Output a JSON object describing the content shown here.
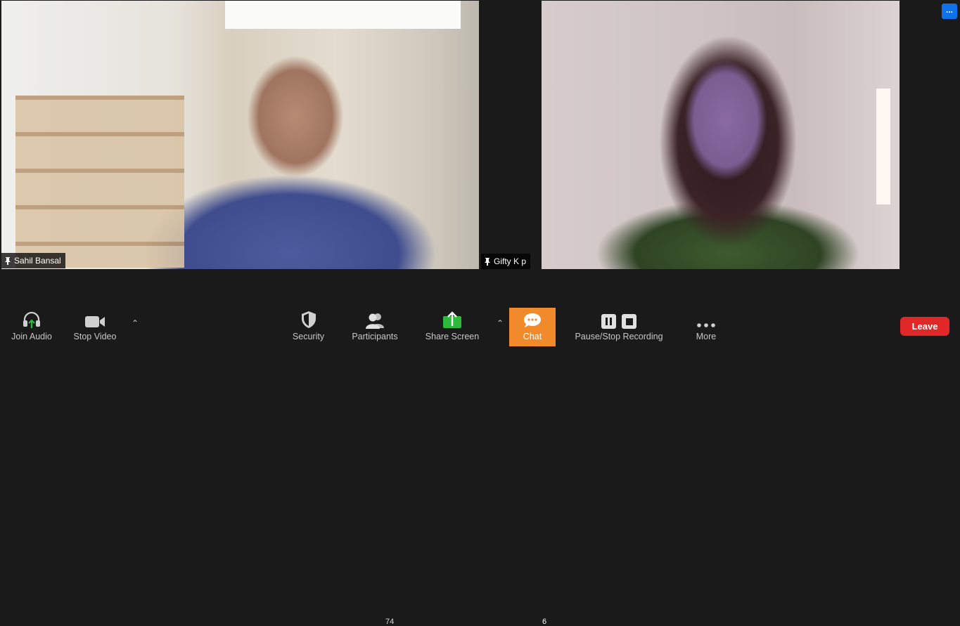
{
  "participants": {
    "left": {
      "name": "Sahil Bansal"
    },
    "right": {
      "name": "Gifty K p"
    }
  },
  "top_right": {
    "more_label": "..."
  },
  "toolbar": {
    "join_audio": "Join Audio",
    "stop_video": "Stop Video",
    "security": "Security",
    "participants": "Participants",
    "participants_count": "74",
    "share_screen": "Share Screen",
    "chat": "Chat",
    "chat_count": "6",
    "recording": "Pause/Stop Recording",
    "more": "More",
    "leave": "Leave"
  },
  "colors": {
    "share_green": "#2dba3a",
    "chat_orange": "#f08a2b",
    "leave_red": "#e02828",
    "more_blue": "#0e72ed"
  }
}
